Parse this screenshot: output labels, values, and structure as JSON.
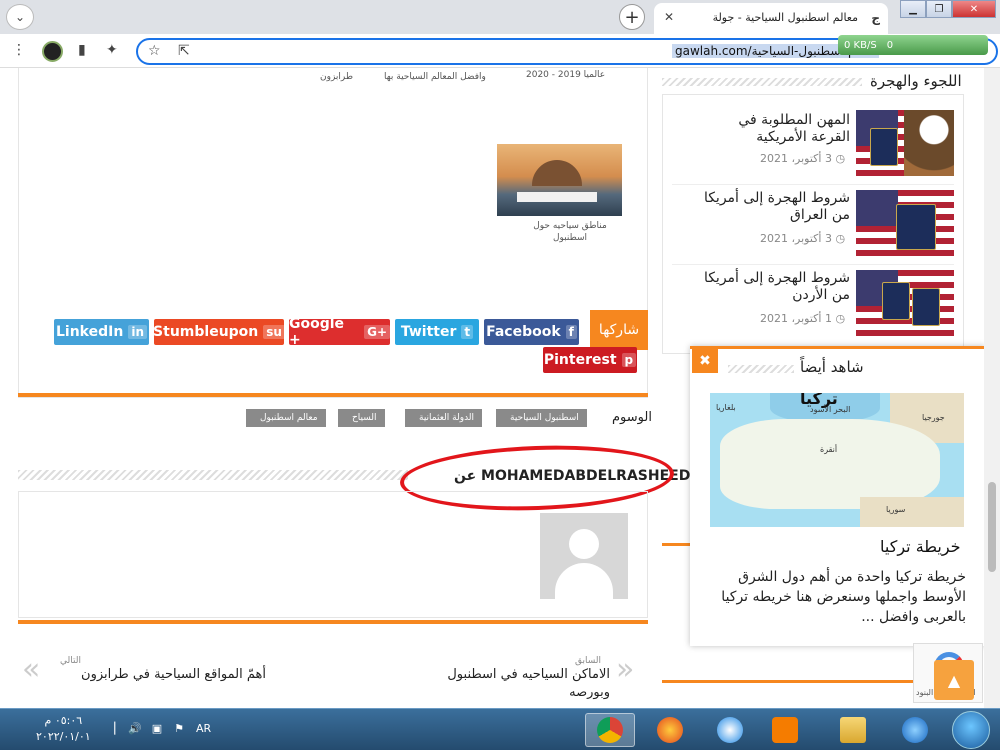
{
  "browser": {
    "tab_title": "معالم اسطنبول السياحية - جولة",
    "url": "gawlah.com/معالم-اسطنبول-السياحية",
    "net_speed": "0 KB/S",
    "net_count": "0"
  },
  "related": {
    "cap1": "عالميا 2019 - 2020",
    "cap2": "وافضل المعالم السياحية بها",
    "cap3": "طرابزون",
    "img_caption": "مناطق سياحيه حول اسطنبول"
  },
  "share": {
    "label": "شاركها",
    "facebook": "Facebook",
    "twitter": "Twitter",
    "google": "Google +",
    "stumbleupon": "Stumbleupon",
    "linkedin": "LinkedIn",
    "pinterest": "Pinterest"
  },
  "tags": {
    "label": "الوسوم",
    "items": [
      "اسطنبول السياحية",
      "الدولة العثمانية",
      "السياح",
      "معالم اسطنبول"
    ]
  },
  "author": {
    "title": "عن MOHAMEDABDELRASHEED"
  },
  "post_nav": {
    "prev_small": "السابق",
    "prev_title": "الاماكن السياحيه في اسطنبول وبورصه",
    "next_small": "التالي",
    "next_title": "أهمّ المواقع السياحية في طرابزون"
  },
  "sidebar": {
    "title": "اللجوء والهجرة",
    "items": [
      {
        "title": "المهن المطلوبة في القرعة الأمريكية",
        "date": "3 أكتوبر، 2021"
      },
      {
        "title": "شروط الهجرة إلى أمريكا من العراق",
        "date": "3 أكتوبر، 2021"
      },
      {
        "title": "شروط الهجرة إلى أمريكا من الأردن",
        "date": "1 أكتوبر، 2021"
      }
    ]
  },
  "popup": {
    "heading": "شاهد أيضاً",
    "map_title": "تركيا",
    "map_labels": [
      "بلغاريا",
      "البحر الأسود",
      "جورجيا",
      "أنقرة",
      "سوريا"
    ],
    "title": "خريطة تركيا",
    "excerpt": "خريطة تركيا واحدة من أهم دول الشرق الأوسط واجملها وسنعرض هنا خريطه تركيا بالعربى وافضل ..."
  },
  "recaptcha": {
    "text": "الخصوصية - البنود"
  },
  "taskbar": {
    "time": "٠٥:٠٦ م",
    "date": "٢٠٢٢/٠١/٠١",
    "lang": "AR"
  },
  "colors": {
    "accent": "#f6871f",
    "facebook": "#3b5998",
    "twitter": "#2aa6e0",
    "google": "#dd2e2e",
    "stumbleupon": "#eb4924",
    "linkedin": "#45a2d9",
    "pinterest": "#cc1b22"
  }
}
